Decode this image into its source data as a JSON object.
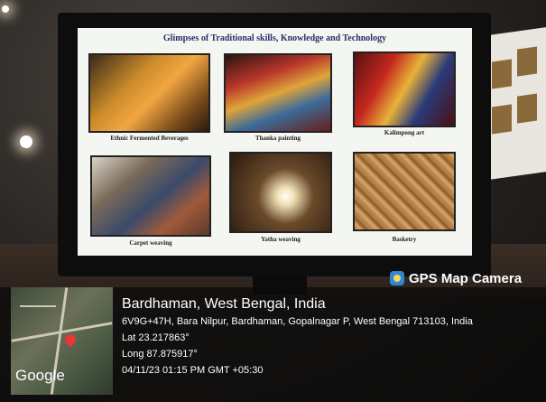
{
  "slide": {
    "title": "Glimpses of Traditional skills, Knowledge and Technology",
    "tiles": [
      {
        "caption": "Ethnic Fermented Beverages"
      },
      {
        "caption": "Thanka painting"
      },
      {
        "caption": "Kalimpong art"
      },
      {
        "caption": "Carpet weaving"
      },
      {
        "caption": "Yatha weaving"
      },
      {
        "caption": "Basketry"
      }
    ]
  },
  "stamp": {
    "app_name": "GPS Map Camera",
    "city": "Bardhaman, West Bengal, India",
    "address": "6V9G+47H, Bara Nilpur, Bardhaman, Gopalnagar P, West Bengal 713103, India",
    "lat": "Lat 23.217863°",
    "long": "Long 87.875917°",
    "datetime": "04/11/23 01:15 PM GMT +05:30",
    "map_logo": "Google"
  }
}
